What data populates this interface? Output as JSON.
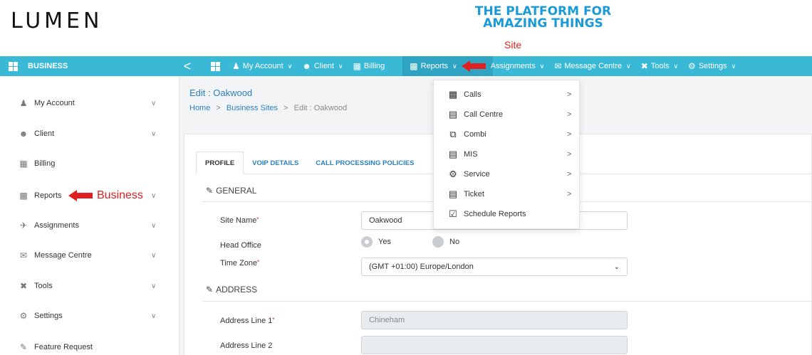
{
  "header": {
    "logo": "LUMEN",
    "tagline_line1": "THE PLATFORM FOR",
    "tagline_line2": "AMAZING THINGS"
  },
  "annotations": {
    "site": "Site",
    "business": "Business",
    "arrow_color": "#e02020"
  },
  "navbar": {
    "brand": "BUSINESS",
    "back": "<",
    "items": [
      {
        "label": "My Account",
        "icon": "user-icon",
        "has_chevron": true
      },
      {
        "label": "Client",
        "icon": "users-icon",
        "has_chevron": true
      },
      {
        "label": "Billing",
        "icon": "billing-icon",
        "has_chevron": false
      },
      {
        "label": "Reports",
        "icon": "bar-chart-icon",
        "has_chevron": true,
        "active": true
      },
      {
        "label": "Assignments",
        "icon": "assign-icon",
        "has_chevron": true
      },
      {
        "label": "Message Centre",
        "icon": "message-icon",
        "has_chevron": true
      },
      {
        "label": "Tools",
        "icon": "tools-icon",
        "has_chevron": true
      },
      {
        "label": "Settings",
        "icon": "settings-icon",
        "has_chevron": true
      }
    ]
  },
  "sidebar": {
    "items": [
      {
        "label": "My Account"
      },
      {
        "label": "Client"
      },
      {
        "label": "Billing"
      },
      {
        "label": "Reports"
      },
      {
        "label": "Assignments"
      },
      {
        "label": "Message Centre"
      },
      {
        "label": "Tools"
      },
      {
        "label": "Settings"
      },
      {
        "label": "Feature Request"
      }
    ]
  },
  "main": {
    "title": "Edit : Oakwood",
    "breadcrumb": {
      "home": "Home",
      "sites": "Business Sites",
      "current": "Edit : Oakwood",
      "sep": ">"
    },
    "tabs": [
      {
        "label": "PROFILE"
      },
      {
        "label": "VOIP DETAILS"
      },
      {
        "label": "CALL PROCESSING POLICIES"
      }
    ],
    "sections": {
      "general": "GENERAL",
      "address": "ADDRESS"
    },
    "fields": {
      "site_name_label": "Site Name",
      "site_name_value": "Oakwood",
      "head_office_label": "Head Office",
      "yes": "Yes",
      "no": "No",
      "time_zone_label": "Time Zone",
      "time_zone_value": "(GMT +01:00) Europe/London",
      "address1_label": "Address Line 1",
      "address1_value": "Chineham",
      "address2_label": "Address Line 2",
      "address2_value": ""
    },
    "required_mark": "*"
  },
  "reports_menu": {
    "items": [
      {
        "label": "Calls",
        "icon": "bar-chart-icon",
        "has_submenu": true
      },
      {
        "label": "Call Centre",
        "icon": "document-icon",
        "has_submenu": true
      },
      {
        "label": "Combi",
        "icon": "copy-icon",
        "has_submenu": true
      },
      {
        "label": "MIS",
        "icon": "file-icon",
        "has_submenu": true
      },
      {
        "label": "Service",
        "icon": "service-icon",
        "has_submenu": true
      },
      {
        "label": "Ticket",
        "icon": "ticket-icon",
        "has_submenu": true
      },
      {
        "label": "Schedule Reports",
        "icon": "clipboard-icon",
        "has_submenu": false
      }
    ],
    "chevron": ">"
  },
  "colors": {
    "nav_bg": "#39b9d6",
    "link": "#2a7fc0",
    "tagline": "#1a9ad6"
  }
}
